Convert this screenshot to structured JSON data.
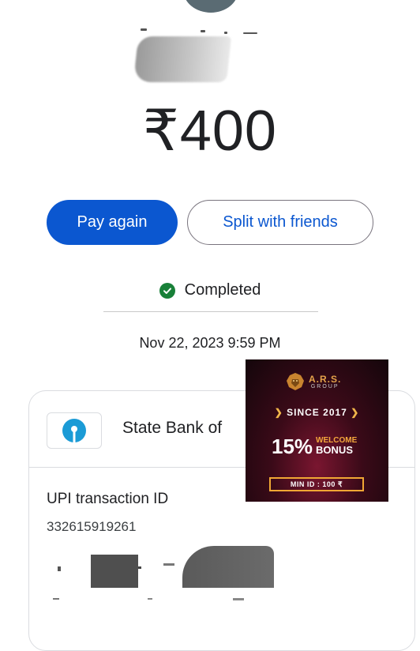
{
  "payment": {
    "amount": "₹400"
  },
  "actions": {
    "pay_again": "Pay again",
    "split": "Split with friends"
  },
  "status": {
    "text": "Completed",
    "color": "#188038"
  },
  "datetime": "Nov 22, 2023 9:59 PM",
  "details": {
    "bank_name": "State Bank of",
    "upi_label": "UPI transaction ID",
    "upi_id": "332615919261"
  },
  "ad": {
    "brand": "A.R.S.",
    "group": "GROUP",
    "since": "SINCE 2017",
    "percent": "15%",
    "welcome": "WELCOME",
    "bonus": "BONUS",
    "min_id": "MIN ID : 100 ₹"
  },
  "colors": {
    "primary": "#0b57d0",
    "text": "#202124"
  }
}
